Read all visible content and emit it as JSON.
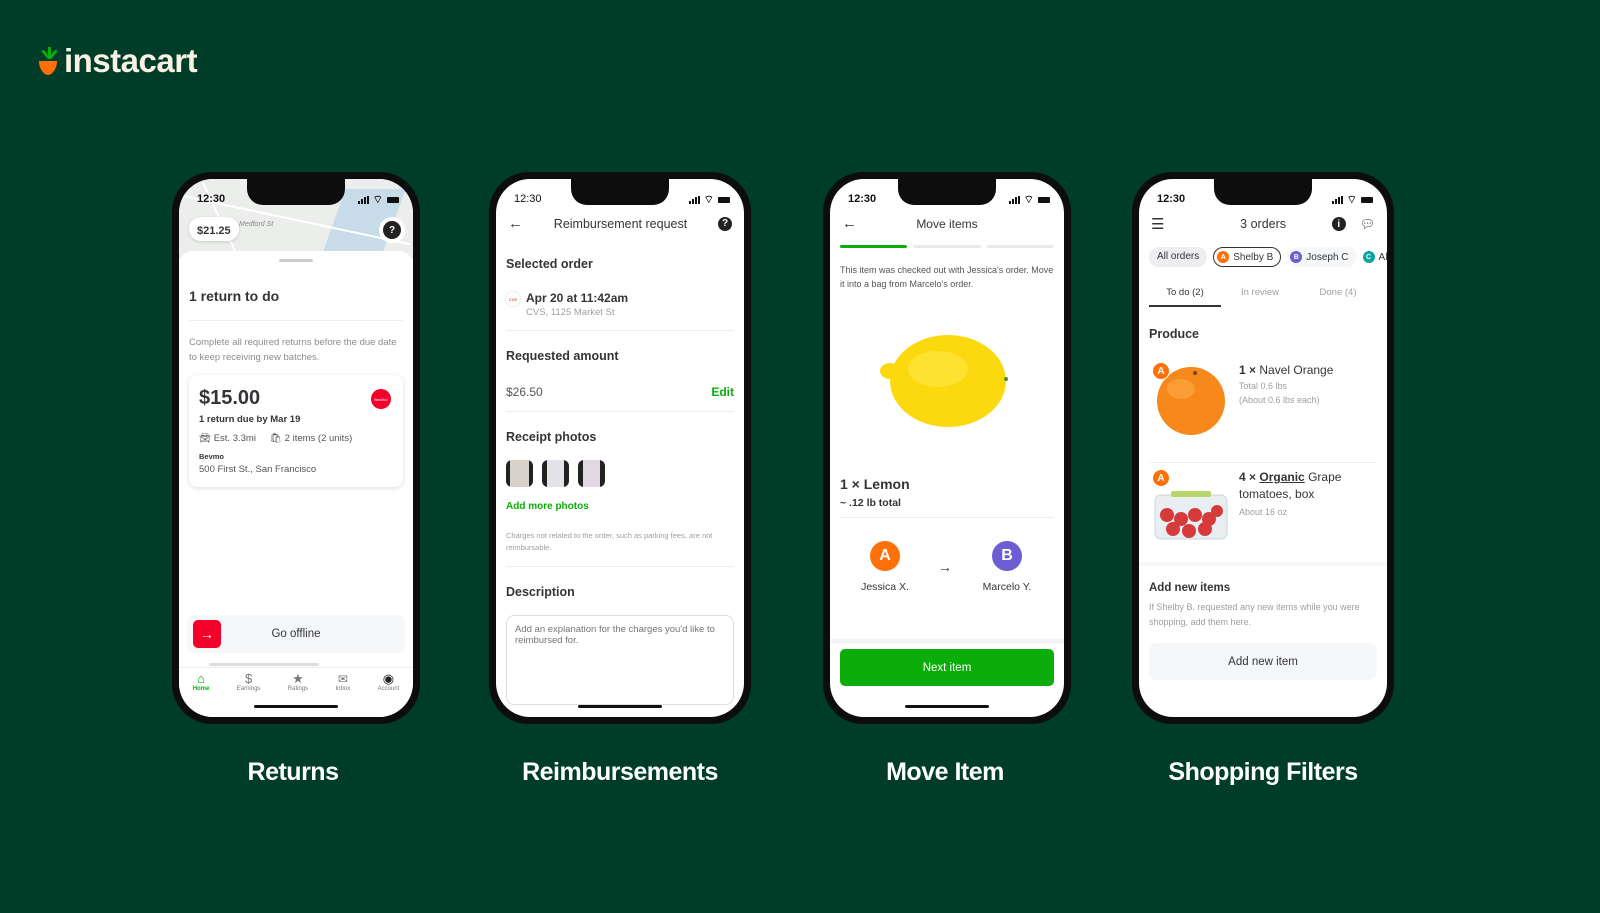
{
  "brand": {
    "name": "instacart",
    "carrot_green": "#0aad0a",
    "carrot_orange": "#ff7009"
  },
  "colors": {
    "background": "#003d29",
    "accent_green": "#0aad0a",
    "alert_red": "#f4002a",
    "avatar_orange": "#ff7009",
    "avatar_purple": "#6c5dd3",
    "avatar_teal": "#0aa3a3"
  },
  "screens": [
    {
      "caption": "Returns",
      "status_time": "12:30",
      "balance": "$21.25",
      "map_street": "Medford St",
      "title": "1 return to do",
      "subtitle": "Complete all required returns before the due date to keep receiving new batches.",
      "card": {
        "amount": "$15.00",
        "due": "1 return due by Mar 19",
        "distance": "Est. 3.3mi",
        "items": "2 items (2 units)",
        "store": "Bevmo",
        "address": "500 First St., San Francisco",
        "store_badge": "BevMo!"
      },
      "go_offline": "Go offline",
      "nav": [
        {
          "label": "Home",
          "icon": "home-icon",
          "active": true
        },
        {
          "label": "Earnings",
          "icon": "dollar-icon"
        },
        {
          "label": "Ratings",
          "icon": "star-icon"
        },
        {
          "label": "Inbox",
          "icon": "mail-icon"
        },
        {
          "label": "Account",
          "icon": "account-icon"
        }
      ]
    },
    {
      "caption": "Reimbursements",
      "status_time": "12:30",
      "title": "Reimbursement request",
      "selected_order_label": "Selected order",
      "order_date": "Apr 20 at 11:42am",
      "order_store": "CVS, 1125 Market St",
      "store_logo": "CVS",
      "requested_amount_label": "Requested amount",
      "amount": "$26.50",
      "edit": "Edit",
      "receipt_photos_label": "Receipt photos",
      "add_photos": "Add more photos",
      "disclaimer": "Charges not related to the order, such as parking fees, are not reimbursable.",
      "description_label": "Description",
      "description_placeholder": "Add an explanation for the charges you'd like to reimbursed for."
    },
    {
      "caption": "Move Item",
      "status_time": "12:30",
      "title": "Move items",
      "progress_steps": 3,
      "progress_current": 1,
      "instruction": "This item was checked out with Jessica's order. Move it into a bag from Marcelo's order.",
      "item_name": "1 × Lemon",
      "item_weight": "~ .12 lb total",
      "from": {
        "letter": "A",
        "name": "Jessica X."
      },
      "to": {
        "letter": "B",
        "name": "Marcelo Y."
      },
      "next_button": "Next item"
    },
    {
      "caption": "Shopping Filters",
      "status_time": "12:30",
      "title": "3 orders",
      "chips": [
        {
          "label": "All orders"
        },
        {
          "label": "Shelby B",
          "letter": "A",
          "selected": true
        },
        {
          "label": "Joseph C",
          "letter": "B"
        },
        {
          "label": "Al",
          "letter": "C"
        }
      ],
      "tabs": [
        {
          "label": "To do (2)",
          "active": true
        },
        {
          "label": "In review"
        },
        {
          "label": "Done (4)"
        }
      ],
      "section": "Produce",
      "items": [
        {
          "letter": "A",
          "qty": "1 ×",
          "name": "Navel Orange",
          "line1": "Total 0.6 lbs",
          "line2": "(About 0.6 lbs each)"
        },
        {
          "letter": "A",
          "qty": "4 ×",
          "organic": "Organic",
          "name": "Grape tomatoes, box",
          "line1": "About 16 oz"
        }
      ],
      "add_title": "Add new items",
      "add_desc": "If Shelby B. requested any new items while you were shopping, add them here.",
      "add_button": "Add new item"
    }
  ]
}
